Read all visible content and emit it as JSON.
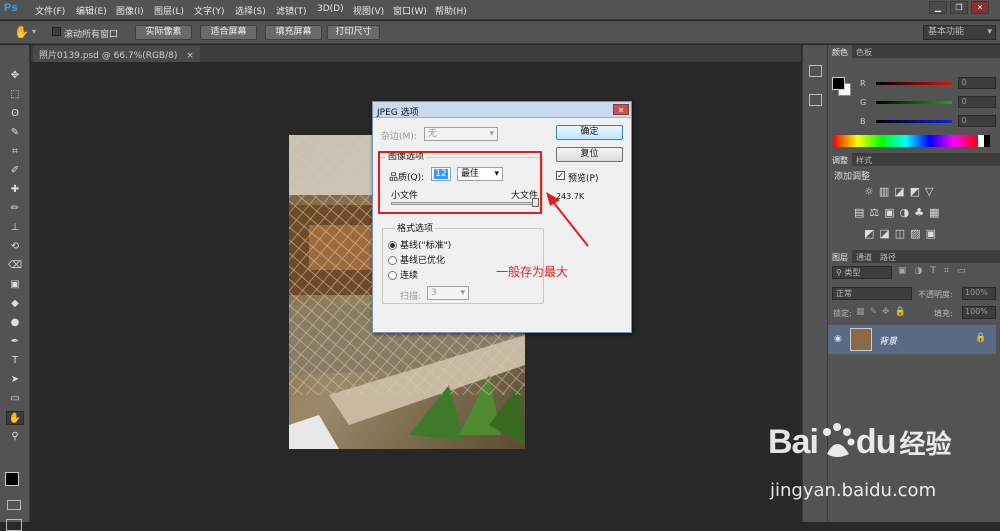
{
  "app": {
    "logo": "Ps"
  },
  "menu": [
    "文件(F)",
    "编辑(E)",
    "图像(I)",
    "图层(L)",
    "文字(Y)",
    "选择(S)",
    "滤镜(T)",
    "3D(D)",
    "视图(V)",
    "窗口(W)",
    "帮助(H)"
  ],
  "window_controls": {
    "minimize": "▁",
    "restore": "❐",
    "close": "✕"
  },
  "options_bar": {
    "scroll_all_label": "滚动所有窗口",
    "actual_pixels": "实际像素",
    "fit_screen": "适合屏幕",
    "fill_screen": "填充屏幕",
    "print_size": "打印尺寸",
    "workspace": "基本功能"
  },
  "document_tab": {
    "title": "照片0139.psd @ 66.7%(RGB/8)",
    "close": "×"
  },
  "tools": [
    "move-icon",
    "marquee-icon",
    "lasso-icon",
    "quick-select-icon",
    "crop-icon",
    "eyedropper-icon",
    "healing-icon",
    "brush-icon",
    "stamp-icon",
    "history-brush-icon",
    "eraser-icon",
    "gradient-icon",
    "blur-icon",
    "dodge-icon",
    "pen-icon",
    "type-icon",
    "path-select-icon",
    "rectangle-icon",
    "hand-icon",
    "zoom-icon"
  ],
  "tool_glyphs": [
    "✥",
    "⬚",
    "ʘ",
    "✎",
    "⌗",
    "✐",
    "✚",
    "✏",
    "⊥",
    "⟲",
    "⌫",
    "▣",
    "◆",
    "●",
    "✒",
    "T",
    "➤",
    "▭",
    "✋",
    "⚲"
  ],
  "color_panel": {
    "tabs": [
      "颜色",
      "色板"
    ],
    "channels": [
      {
        "label": "R",
        "value": "0",
        "color": "#e01010"
      },
      {
        "label": "G",
        "value": "0",
        "color": "#10b010"
      },
      {
        "label": "B",
        "value": "0",
        "color": "#1020e0"
      }
    ]
  },
  "adjust_panel": {
    "tabs": [
      "调整",
      "样式"
    ],
    "title": "添加调整"
  },
  "layers_panel": {
    "tabs": [
      "图层",
      "通道",
      "路径"
    ],
    "filter_label": "类型",
    "blend_mode": "正常",
    "opacity_label": "不透明度:",
    "opacity_value": "100%",
    "lock_label": "锁定:",
    "fill_label": "填充:",
    "fill_value": "100%",
    "layer_name": "背景"
  },
  "dialog": {
    "title": "JPEG 选项",
    "close": "✕",
    "matte_label": "杂边(M):",
    "matte_value": "无",
    "image_options_group": "图像选项",
    "quality_label": "品质(Q):",
    "quality_value": "12",
    "quality_preset": "最佳",
    "small_file": "小文件",
    "large_file": "大文件",
    "quality_slider": 1.0,
    "format_group": "格式选项",
    "formats": [
      "基线(\"标准\")",
      "基线已优化",
      "连续"
    ],
    "selected_format": 0,
    "scans_label": "扫描:",
    "scans_value": "3",
    "ok": "确定",
    "reset": "复位",
    "preview_label": "预览(P)",
    "preview_checked": true,
    "file_size": "243.7K"
  },
  "annotation": {
    "text": "一般存为最大",
    "color": "#e0201f"
  },
  "watermark": {
    "brand": "Bai",
    "brand2": "du",
    "jingyan": "经验",
    "url": "jingyan.baidu.com"
  }
}
